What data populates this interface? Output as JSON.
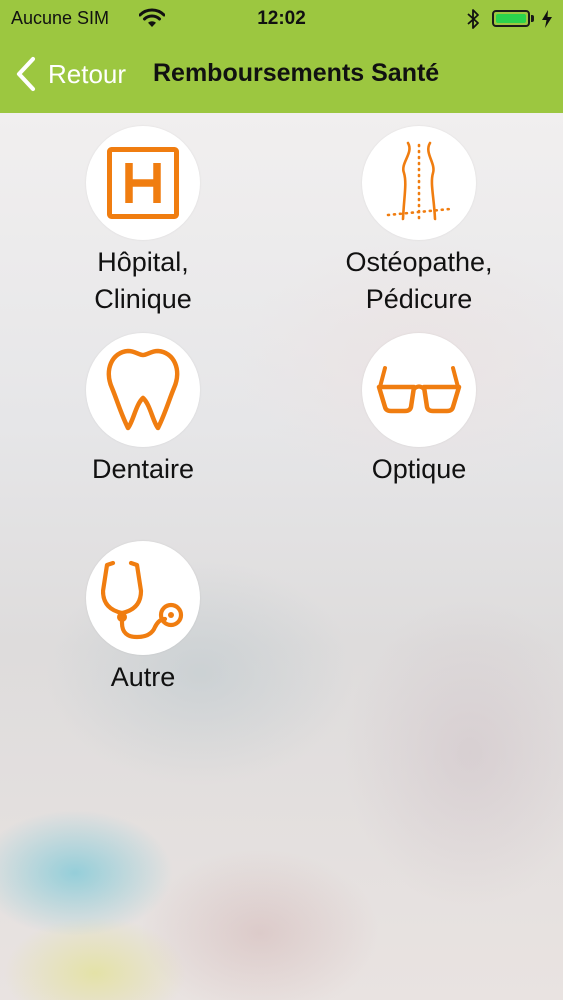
{
  "status_bar": {
    "carrier": "Aucune SIM",
    "time": "12:02",
    "icons": [
      "wifi-icon",
      "bluetooth-icon",
      "battery-icon",
      "charging-bolt-icon"
    ],
    "battery_color": "#2bd34c"
  },
  "nav": {
    "back_label": "Retour",
    "title": "Remboursements Santé",
    "back_icon": "chevron-left-icon"
  },
  "colors": {
    "bar_green": "#9cc740",
    "icon_orange": "#f07d10",
    "circle_white": "#ffffff"
  },
  "categories": [
    {
      "id": "hopital",
      "label_lines": [
        "Hôpital,",
        "Clinique"
      ],
      "icon": "hospital-icon"
    },
    {
      "id": "osteopathe",
      "label_lines": [
        "Ostéopathe,",
        "Pédicure"
      ],
      "icon": "spine-feet-icon"
    },
    {
      "id": "dentaire",
      "label_lines": [
        "Dentaire"
      ],
      "icon": "tooth-icon"
    },
    {
      "id": "optique",
      "label_lines": [
        "Optique"
      ],
      "icon": "glasses-icon"
    },
    {
      "id": "autre",
      "label_lines": [
        "Autre"
      ],
      "icon": "stethoscope-icon"
    }
  ]
}
